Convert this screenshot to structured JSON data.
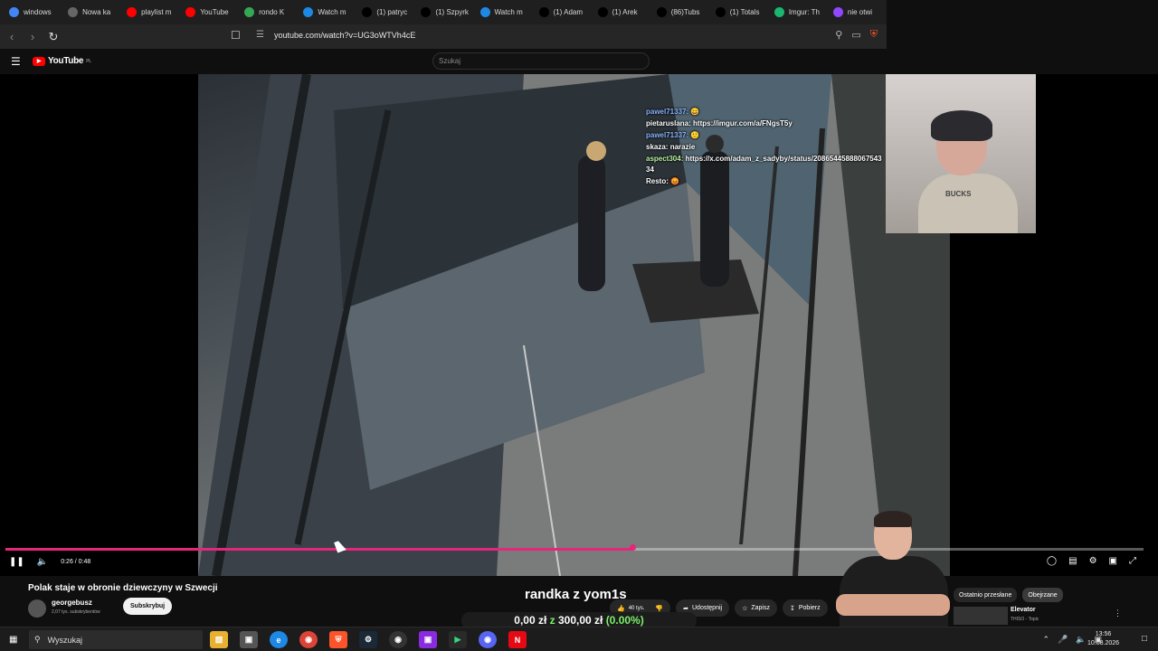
{
  "browser": {
    "tabs": [
      {
        "label": "windows",
        "icon": "google-icon",
        "color": "#4285f4"
      },
      {
        "label": "Nowa ka",
        "icon": "shield-icon",
        "color": "#666666"
      },
      {
        "label": "playlist m",
        "icon": "youtube-icon",
        "color": "#ff0000"
      },
      {
        "label": "YouTube",
        "icon": "youtube-icon",
        "color": "#ff0000"
      },
      {
        "label": "rondo K",
        "icon": "maps-icon",
        "color": "#34a853"
      },
      {
        "label": "Watch m",
        "icon": "watch-icon",
        "color": "#1e88e5"
      },
      {
        "label": "(1) patryc",
        "icon": "x-icon",
        "color": "#000000"
      },
      {
        "label": "(1) Szpyrk",
        "icon": "x-icon",
        "color": "#000000"
      },
      {
        "label": "Watch m",
        "icon": "watch-icon",
        "color": "#1e88e5"
      },
      {
        "label": "(1) Adam",
        "icon": "x-icon",
        "color": "#000000"
      },
      {
        "label": "(1) Arek",
        "icon": "x-icon",
        "color": "#000000"
      },
      {
        "label": "(86)Tubs",
        "icon": "tiktok-icon",
        "color": "#000000"
      },
      {
        "label": "(1) Totals",
        "icon": "x-icon",
        "color": "#000000"
      },
      {
        "label": "Imgur: Th",
        "icon": "imgur-icon",
        "color": "#1bb76e"
      },
      {
        "label": "nie otwi",
        "icon": "twitch-icon",
        "color": "#9146ff"
      }
    ],
    "url": "youtube.com/watch?v=UG3oWTVh4cE"
  },
  "youtube": {
    "logo_text": "YouTube",
    "logo_region": "PL",
    "search_placeholder": "Szukaj"
  },
  "chat": [
    {
      "user": "pawel71337:",
      "text": "😄",
      "color": "#8ab4ff"
    },
    {
      "user": "pietaruslana:",
      "text": "https://imgur.com/a/FNgsT5y",
      "color": "#ffffff"
    },
    {
      "user": "pawel71337:",
      "text": "🙂",
      "color": "#8ab4ff"
    },
    {
      "user": "skaza:",
      "text": "narazie",
      "color": "#ffffff"
    },
    {
      "user": "aspect304:",
      "text": "https://x.com/adam_z_sadyby/status/2086544588806754334",
      "color": "#b8f4a0"
    },
    {
      "user": "Resto:",
      "text": "😡",
      "color": "#ffffff"
    }
  ],
  "player": {
    "time": "0:26 / 0:48",
    "progress": 0.551,
    "accent": "#e5267c"
  },
  "video_info": {
    "title": "Polak staje w obronie dziewczyny w Szwecji",
    "channel": "georgebusz",
    "subscribers": "2,07 tys. subskrybentów",
    "subscribe_label": "Subskrybuj",
    "likes": "40 tys.",
    "share_label": "Udostępnij",
    "save_label": "Zapisz",
    "download_label": "Pobierz"
  },
  "overlay": {
    "title": "randka z yom1s",
    "donate_left": "0,00 zł",
    "donate_mid": " z ",
    "donate_right": "300,00 zł",
    "donate_pct": "(0.00%)"
  },
  "webcam": {
    "shirt_text": "BUCKS"
  },
  "sidebar": {
    "chips": [
      "Ostatnio przesłane",
      "Obejrzane"
    ],
    "rec_title": "Elevator",
    "rec_sub": "THISO - Topic"
  },
  "taskbar": {
    "search_placeholder": "Wyszukaj",
    "time": "13:56",
    "date": "10.08.2026"
  }
}
